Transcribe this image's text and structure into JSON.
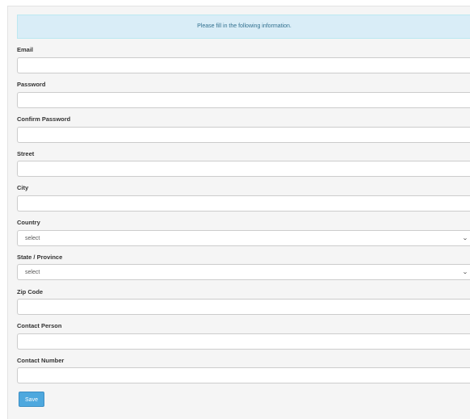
{
  "form": {
    "info_message": "Please fill in the following information.",
    "fields": [
      {
        "label": "Email",
        "value": ""
      },
      {
        "label": "Password",
        "value": ""
      },
      {
        "label": "Confirm Password",
        "value": ""
      },
      {
        "label": "Street",
        "value": ""
      },
      {
        "label": "City",
        "value": ""
      },
      {
        "label": "Country",
        "selected": "select"
      },
      {
        "label": "State / Province",
        "selected": "select"
      },
      {
        "label": "Zip Code",
        "value": ""
      },
      {
        "label": "Contact Person",
        "value": ""
      },
      {
        "label": "Contact Number",
        "value": ""
      }
    ],
    "save_label": "Save"
  },
  "colors": {
    "alert_bg": "#d9edf7",
    "alert_text": "#31708f",
    "button_bg": "#4ea8de"
  },
  "icons": {
    "dropdown": "chevron-down-icon"
  }
}
